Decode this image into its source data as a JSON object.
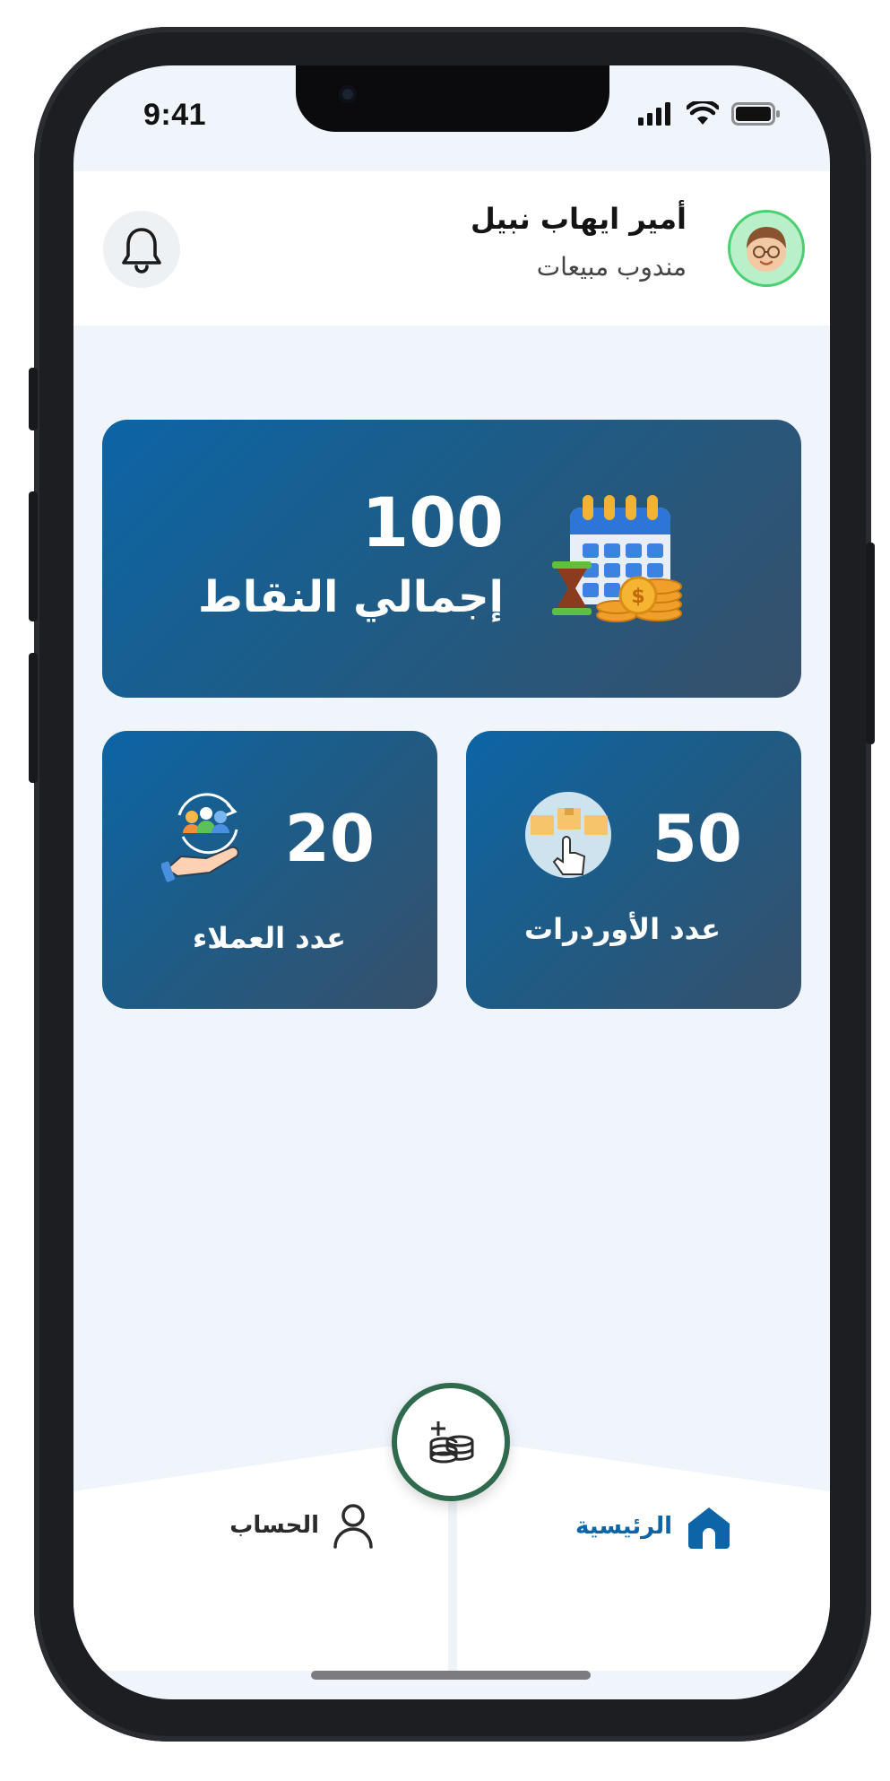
{
  "status_bar": {
    "time": "9:41"
  },
  "user": {
    "name": "أمير ايهاب نبيل",
    "role": "مندوب مبيعات"
  },
  "stats": {
    "total_points": {
      "value": "100",
      "label": "إجمالي النقاط"
    },
    "orders": {
      "value": "50",
      "label": "عدد الأوردرات"
    },
    "customers": {
      "value": "20",
      "label": "عدد العملاء"
    }
  },
  "nav": {
    "home_label": "الرئيسية",
    "account_label": "الحساب"
  },
  "colors": {
    "accent": "#0c65a6",
    "card_end": "#37506a",
    "fab_ring": "#2f6a4e",
    "bg": "#f0f5fc"
  },
  "icons": [
    "bell-icon",
    "avatar",
    "calendar-coins-icon",
    "boxes-tap-icon",
    "customers-hand-icon",
    "coins-add-icon",
    "home-icon",
    "user-icon"
  ]
}
